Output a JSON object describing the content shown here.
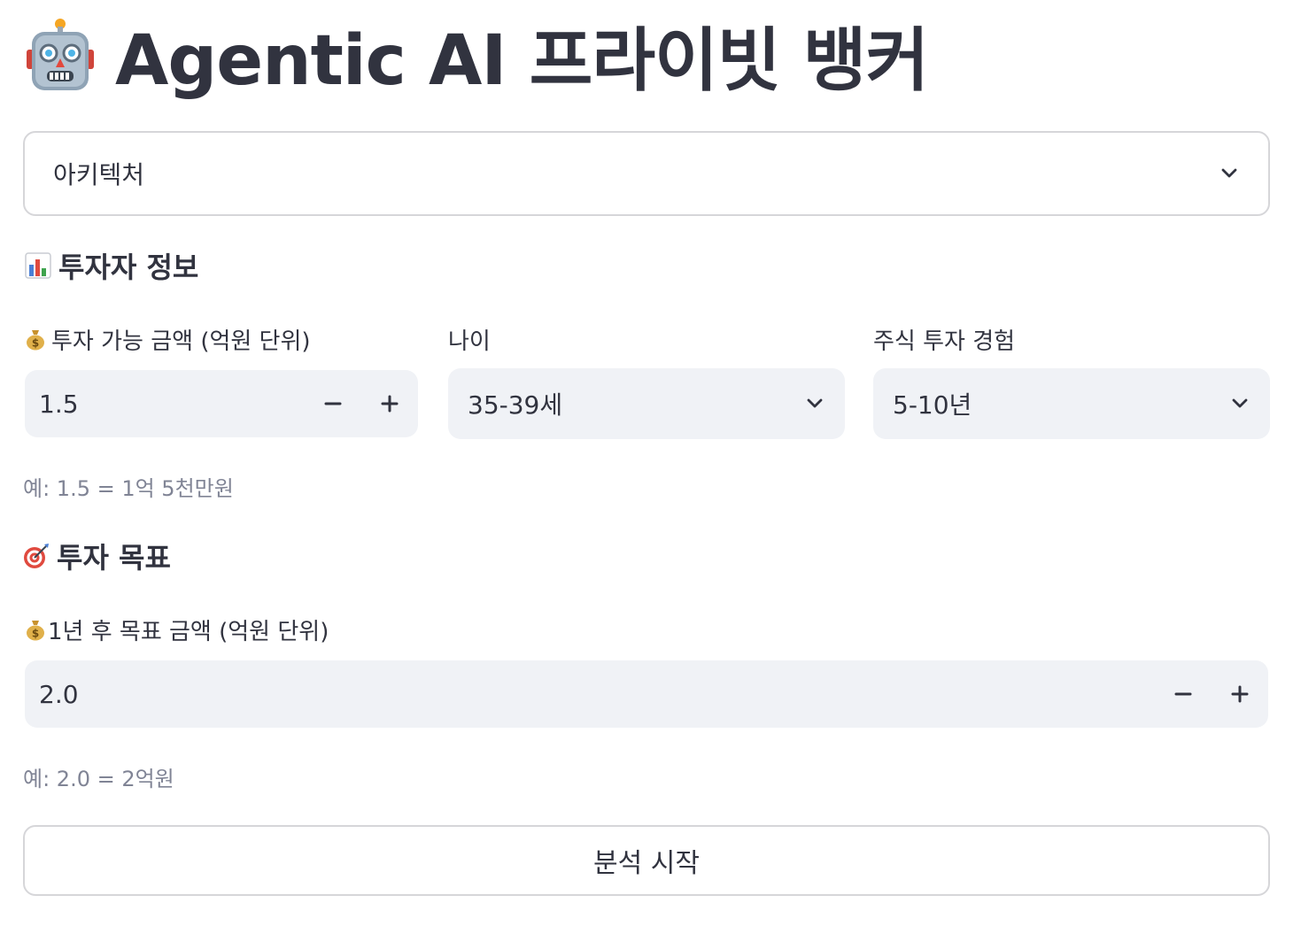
{
  "app": {
    "title": "Agentic AI 프라이빗 뱅커",
    "title_icon": "robot-icon"
  },
  "view_select": {
    "value": "아키텍처",
    "icon": "chevron-down-icon"
  },
  "investor_section": {
    "heading": "투자자 정보",
    "icon": "bar-chart-icon",
    "amount": {
      "label": "투자 가능 금액 (억원 단위)",
      "icon": "money-bag-icon",
      "value": "1.5",
      "help": "예: 1.5 = 1억 5천만원",
      "decrement": "−",
      "increment": "+"
    },
    "age": {
      "label": "나이",
      "value": "35-39세"
    },
    "experience": {
      "label": "주식 투자 경험",
      "value": "5-10년"
    }
  },
  "goal_section": {
    "heading": "투자 목표",
    "icon": "target-icon",
    "target_amount": {
      "label": "1년 후 목표 금액 (억원 단위)",
      "icon": "money-bag-icon",
      "value": "2.0",
      "help": "예: 2.0 = 2억원",
      "decrement": "−",
      "increment": "+"
    }
  },
  "actions": {
    "start_label": "분석 시작"
  },
  "colors": {
    "text": "#31333f",
    "muted": "#808495",
    "input_bg": "#f0f2f6",
    "border": "#d6d6d9"
  }
}
